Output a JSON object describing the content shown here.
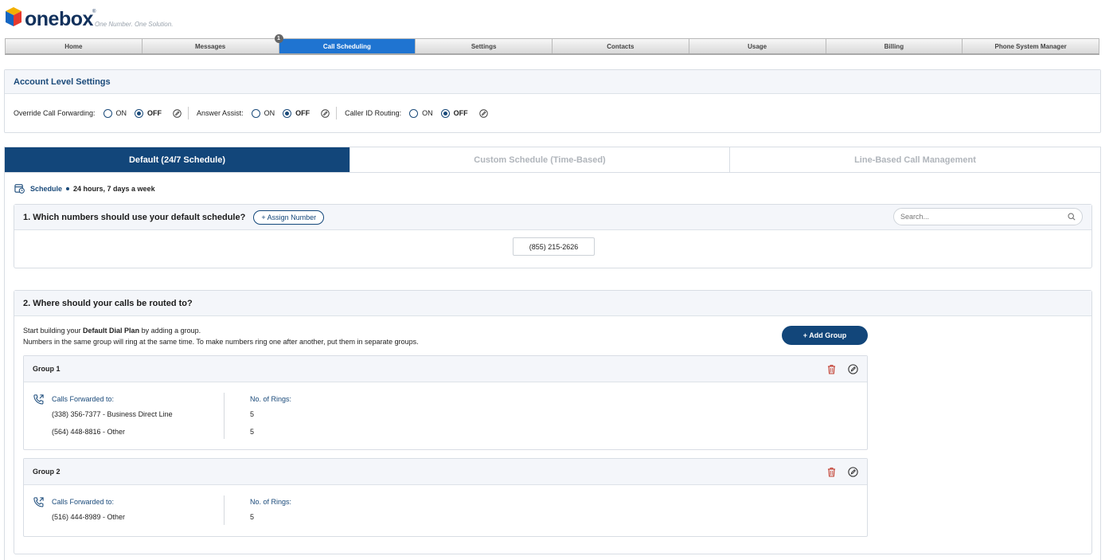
{
  "brand": {
    "name": "onebox",
    "registered": "®",
    "tagline": "One Number. One Solution."
  },
  "nav": {
    "items": [
      {
        "label": "Home"
      },
      {
        "label": "Messages",
        "badge": "1"
      },
      {
        "label": "Call Scheduling",
        "active": true
      },
      {
        "label": "Settings"
      },
      {
        "label": "Contacts"
      },
      {
        "label": "Usage"
      },
      {
        "label": "Billing"
      },
      {
        "label": "Phone System Manager"
      }
    ]
  },
  "account": {
    "title": "Account Level Settings",
    "settings": [
      {
        "label": "Override Call Forwarding:",
        "on": "ON",
        "off": "OFF",
        "selected": "OFF"
      },
      {
        "label": "Answer Assist:",
        "on": "ON",
        "off": "OFF",
        "selected": "OFF"
      },
      {
        "label": "Caller ID Routing:",
        "on": "ON",
        "off": "OFF",
        "selected": "OFF"
      }
    ]
  },
  "tabs": [
    {
      "label": "Default (24/7 Schedule)",
      "active": true
    },
    {
      "label": "Custom Schedule (Time-Based)"
    },
    {
      "label": "Line-Based Call Management"
    }
  ],
  "schedule": {
    "label": "Schedule",
    "value": "24 hours, 7 days a week"
  },
  "section1": {
    "title": "1. Which numbers should use your default schedule?",
    "assign_label": "+ Assign Number",
    "search_placeholder": "Search...",
    "numbers": [
      "(855) 215-2626"
    ]
  },
  "section2": {
    "title": "2. Where should your calls be routed to?",
    "intro_prefix": "Start building your ",
    "intro_bold": "Default Dial Plan",
    "intro_suffix": " by adding a group.",
    "intro_line2": "Numbers in the same group will ring at the same time. To make numbers ring one after another, put them in separate groups.",
    "add_group_label": "+ Add Group",
    "forward_header": "Calls Forwarded to:",
    "rings_header": "No. of Rings:",
    "groups": [
      {
        "name": "Group 1",
        "entries": [
          {
            "number": "(338) 356-7377 - Business Direct Line",
            "rings": "5"
          },
          {
            "number": "(564) 448-8816 - Other",
            "rings": "5"
          }
        ]
      },
      {
        "name": "Group 2",
        "entries": [
          {
            "number": "(516) 444-8989 - Other",
            "rings": "5"
          }
        ]
      }
    ]
  },
  "colors": {
    "primary": "#12467a",
    "nav_active": "#1f74d1",
    "delete": "#c0392b"
  }
}
